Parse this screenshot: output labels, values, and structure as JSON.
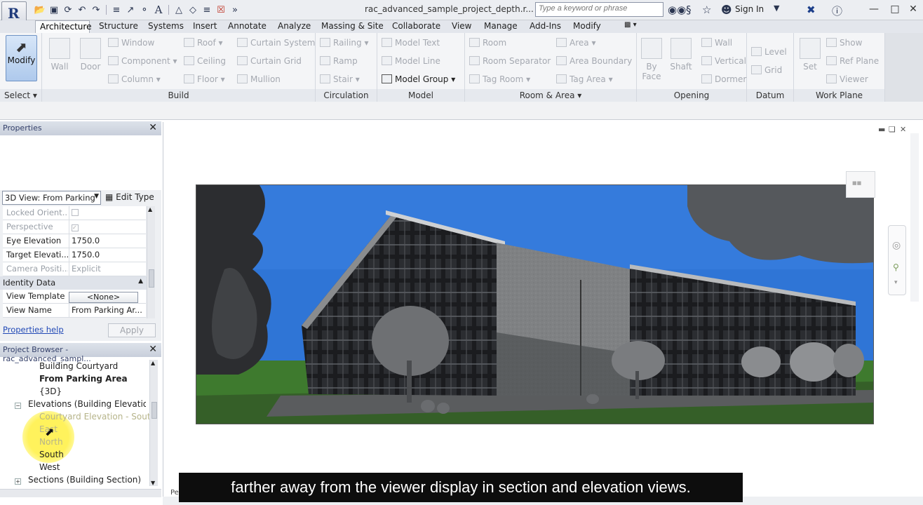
{
  "window": {
    "doc_title": "rac_advanced_sample_project_depth.r...",
    "search_placeholder": "Type a keyword or phrase",
    "sign_in": "Sign In"
  },
  "ribbon_tabs": [
    "Architecture",
    "Structure",
    "Systems",
    "Insert",
    "Annotate",
    "Analyze",
    "Massing & Site",
    "Collaborate",
    "View",
    "Manage",
    "Add-Ins",
    "Modify"
  ],
  "ribbon": {
    "select": {
      "modify": "Modify",
      "label": "Select"
    },
    "build": {
      "label": "Build",
      "wall": "Wall",
      "door": "Door",
      "window": "Window",
      "component": "Component",
      "column": "Column",
      "roof": "Roof",
      "ceiling": "Ceiling",
      "floor": "Floor",
      "curtain_system": "Curtain System",
      "curtain_grid": "Curtain Grid",
      "mullion": "Mullion"
    },
    "circulation": {
      "label": "Circulation",
      "railing": "Railing",
      "ramp": "Ramp",
      "stair": "Stair"
    },
    "model": {
      "label": "Model",
      "model_text": "Model Text",
      "model_line": "Model Line",
      "model_group": "Model Group"
    },
    "room_area": {
      "label": "Room & Area",
      "room": "Room",
      "room_separator": "Room Separator",
      "tag_room": "Tag Room",
      "area": "Area",
      "area_boundary": "Area Boundary",
      "tag_area": "Tag Area"
    },
    "opening": {
      "label": "Opening",
      "by_face": "By Face",
      "shaft": "Shaft",
      "wall": "Wall",
      "vertical": "Vertical",
      "dormer": "Dormer"
    },
    "datum": {
      "label": "Datum",
      "level": "Level",
      "grid": "Grid"
    },
    "work_plane": {
      "label": "Work Plane",
      "set": "Set",
      "show": "Show",
      "ref_plane": "Ref Plane",
      "viewer": "Viewer"
    }
  },
  "properties": {
    "title": "Properties",
    "type_selector": "3D View: From Parking",
    "edit_type": "Edit Type",
    "rows": [
      {
        "key": "Locked Orient...",
        "value": ""
      },
      {
        "key": "Perspective",
        "value": ""
      },
      {
        "key": "Eye Elevation",
        "value": "1750.0"
      },
      {
        "key": "Target Elevati...",
        "value": "1750.0"
      },
      {
        "key": "Camera Positi...",
        "value": "Explicit"
      }
    ],
    "identity_group": "Identity Data",
    "identity_rows": [
      {
        "key": "View Template",
        "value": "<None>"
      },
      {
        "key": "View Name",
        "value": "From Parking Ar..."
      }
    ],
    "help_link": "Properties help",
    "apply": "Apply"
  },
  "browser": {
    "title": "Project Browser - rac_advanced_sampl...",
    "items": {
      "building_courtyard": "Building Courtyard",
      "from_parking_area": "From Parking Area",
      "three_d": "{3D}",
      "elevations": "Elevations (Building Elevation",
      "courtyard_south": "Courtyard Elevation - South",
      "east": "East",
      "north": "North",
      "south": "South",
      "west": "West",
      "sections": "Sections (Building Section)"
    }
  },
  "status": {
    "partial": "Per"
  },
  "subtitle": "farther away from the viewer display in section and elevation views.",
  "colors": {
    "sky": "#2f75d6",
    "grass": "#3e7a2e",
    "ribbon_active": "#aec9ec"
  }
}
